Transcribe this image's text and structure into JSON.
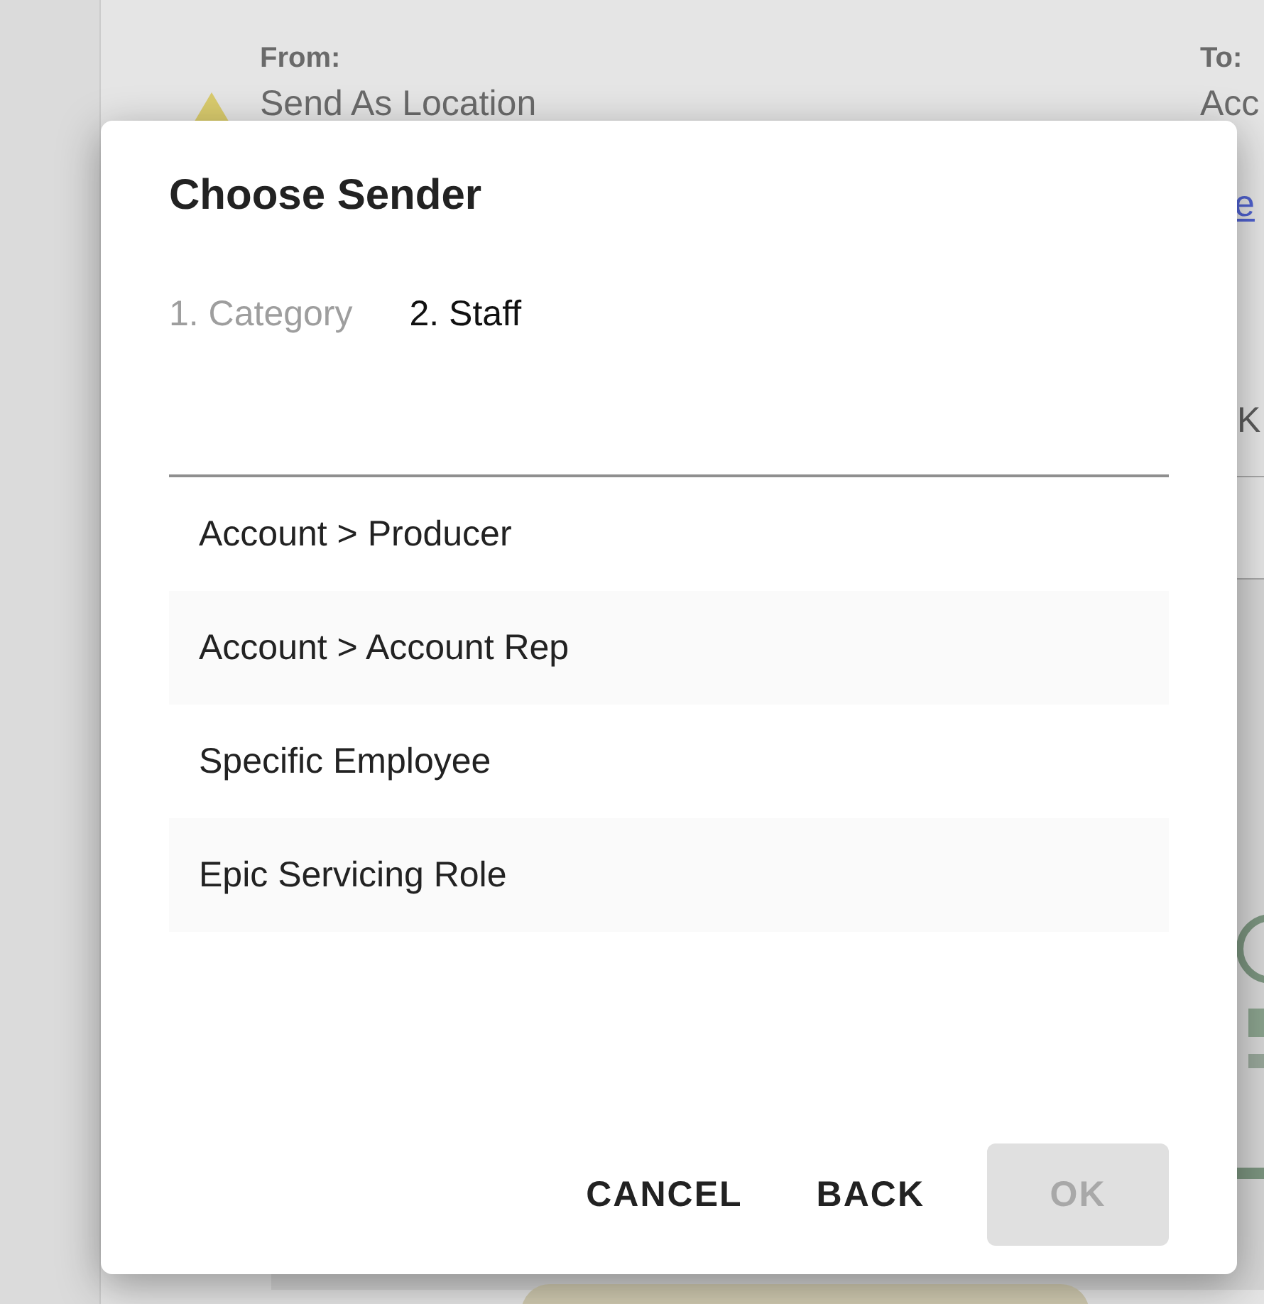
{
  "background": {
    "from_label": "From:",
    "from_value": "Send As Location",
    "to_label": "To:",
    "to_value": "Acc",
    "link": "e",
    "column_text": "K"
  },
  "dialog": {
    "title": "Choose Sender",
    "steps": [
      {
        "label": "1. Category",
        "selected": false
      },
      {
        "label": "2. Staff",
        "selected": true
      }
    ],
    "options": [
      {
        "label": "Account > Producer"
      },
      {
        "label": "Account > Account Rep"
      },
      {
        "label": "Specific Employee"
      },
      {
        "label": "Epic Servicing Role"
      }
    ],
    "buttons": [
      {
        "label": "CANCEL",
        "disabled": false
      },
      {
        "label": "BACK",
        "disabled": false
      },
      {
        "label": "OK",
        "disabled": true
      }
    ]
  }
}
